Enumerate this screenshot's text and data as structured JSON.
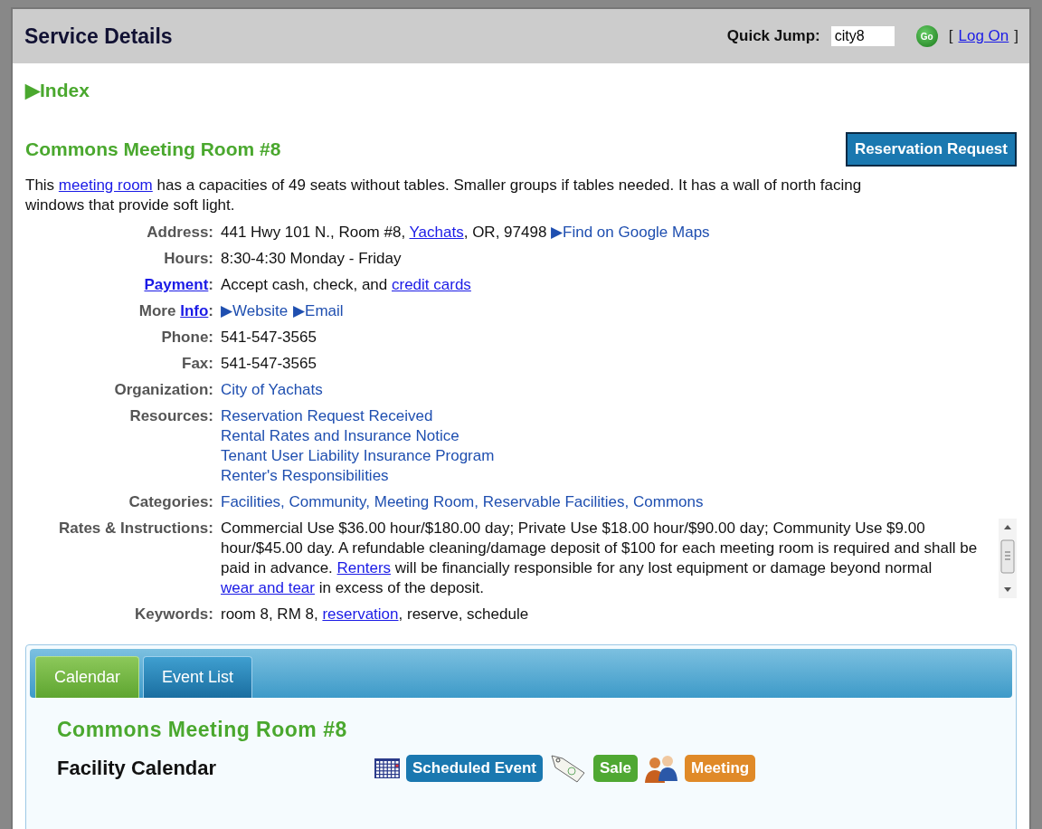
{
  "header": {
    "title": "Service Details",
    "quick_jump_label": "Quick Jump:",
    "quick_jump_value": "city8",
    "go_label": "Go",
    "login_open": "[",
    "login_link": "Log On",
    "login_close": "]"
  },
  "index_link": {
    "arrow": "▶",
    "label": "Index"
  },
  "service": {
    "title": "Commons Meeting Room #8",
    "reserve_button": "Reservation Request",
    "description": [
      {
        "kind": "text",
        "text": "This "
      },
      {
        "kind": "anchor",
        "text": "meeting room"
      },
      {
        "kind": "text",
        "text": " has a capacities of 49 seats without tables. Smaller groups if tables needed. It has a wall of north facing windows that provide soft light."
      }
    ]
  },
  "details": [
    {
      "label": [
        {
          "kind": "text",
          "text": "Address:"
        }
      ],
      "lines": [
        [
          {
            "kind": "text",
            "text": "441 Hwy 101 N., Room #8, "
          },
          {
            "kind": "anchor",
            "text": "Yachats"
          },
          {
            "kind": "text",
            "text": ", OR, 97498 "
          },
          {
            "kind": "nav",
            "text": "▶Find on Google Maps"
          }
        ]
      ]
    },
    {
      "label": [
        {
          "kind": "text",
          "text": "Hours:"
        }
      ],
      "lines": [
        [
          {
            "kind": "text",
            "text": "8:30-4:30 Monday - Friday"
          }
        ]
      ]
    },
    {
      "label": [
        {
          "kind": "anchor",
          "text": "Payment"
        },
        {
          "kind": "text",
          "text": ":"
        }
      ],
      "lines": [
        [
          {
            "kind": "text",
            "text": "Accept cash, check, and "
          },
          {
            "kind": "anchor",
            "text": "credit cards"
          }
        ]
      ]
    },
    {
      "label": [
        {
          "kind": "text",
          "text": "More "
        },
        {
          "kind": "anchor",
          "text": "Info"
        },
        {
          "kind": "text",
          "text": ":"
        }
      ],
      "lines": [
        [
          {
            "kind": "nav",
            "text": "▶Website"
          },
          {
            "kind": "nav",
            "text": "▶Email"
          }
        ]
      ]
    },
    {
      "label": [
        {
          "kind": "text",
          "text": "Phone:"
        }
      ],
      "lines": [
        [
          {
            "kind": "text",
            "text": "541-547-3565"
          }
        ]
      ]
    },
    {
      "label": [
        {
          "kind": "text",
          "text": "Fax:"
        }
      ],
      "lines": [
        [
          {
            "kind": "text",
            "text": "541-547-3565"
          }
        ]
      ]
    },
    {
      "label": [
        {
          "kind": "text",
          "text": "Organization:"
        }
      ],
      "lines": [
        [
          {
            "kind": "nav",
            "text": "City of Yachats"
          }
        ]
      ]
    },
    {
      "label": [
        {
          "kind": "text",
          "text": "Resources:"
        }
      ],
      "lines": [
        [
          {
            "kind": "nav",
            "text": "Reservation Request Received"
          }
        ],
        [
          {
            "kind": "nav",
            "text": "Rental Rates and Insurance Notice"
          }
        ],
        [
          {
            "kind": "nav",
            "text": "Tenant User Liability Insurance Program"
          }
        ],
        [
          {
            "kind": "nav",
            "text": "Renter's Responsibilities"
          }
        ]
      ]
    },
    {
      "label": [
        {
          "kind": "text",
          "text": "Categories:"
        }
      ],
      "lines": [
        [
          {
            "kind": "nav",
            "text": "Facilities, Community, Meeting Room, Reservable Facilities, Commons"
          }
        ]
      ]
    },
    {
      "label": [
        {
          "kind": "text",
          "text": "Rates & Instructions:"
        }
      ],
      "scroll": true,
      "lines": [
        [
          {
            "kind": "text",
            "text": "Commercial Use $36.00 hour/$180.00 day; Private Use $18.00 hour/$90.00 day; Community Use $9.00 hour/$45.00 day. A refundable cleaning/damage deposit of $100 for each meeting room is required and shall be paid in advance. "
          },
          {
            "kind": "anchor",
            "text": "Renters"
          },
          {
            "kind": "text",
            "text": " will be financially responsible for any lost equipment or damage beyond normal "
          },
          {
            "kind": "anchor",
            "text": "wear and tear"
          },
          {
            "kind": "text",
            "text": " in excess of the deposit."
          }
        ]
      ]
    },
    {
      "label": [
        {
          "kind": "text",
          "text": "Keywords:"
        }
      ],
      "lines": [
        [
          {
            "kind": "text",
            "text": "room 8, RM 8, "
          },
          {
            "kind": "anchor",
            "text": "reservation"
          },
          {
            "kind": "text",
            "text": ", reserve, schedule"
          }
        ]
      ]
    }
  ],
  "calendar": {
    "tabs": [
      {
        "label": "Calendar",
        "selected": true
      },
      {
        "label": "Event List",
        "selected": false
      }
    ],
    "title": "Commons Meeting Room #8",
    "subtitle": "Facility Calendar",
    "legend": [
      {
        "label": "Scheduled Event",
        "color": "#1a78b0"
      },
      {
        "label": "Sale",
        "color": "#4fa832"
      },
      {
        "label": "Meeting",
        "color": "#e08a28"
      }
    ]
  }
}
